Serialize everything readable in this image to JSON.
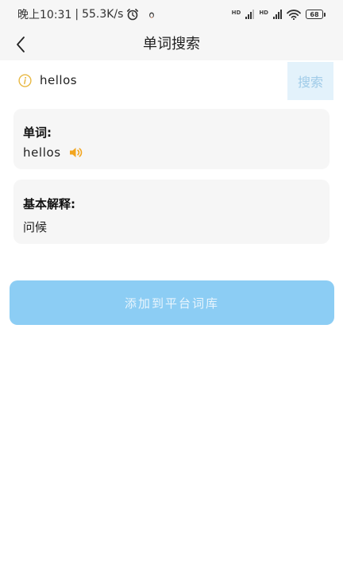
{
  "status_bar": {
    "time": "晚上10:31",
    "separator": "|",
    "net_speed": "55.3K/s",
    "battery": "68",
    "sim1_label": "HD",
    "sim2_label": "HD"
  },
  "nav": {
    "title": "单词搜索"
  },
  "search": {
    "value": "hellos",
    "button_label": "搜索"
  },
  "word_card": {
    "label": "单词:",
    "word": "hellos"
  },
  "definition_card": {
    "label": "基本解释:",
    "text": "问候"
  },
  "add_button": {
    "label": "添加到平台词库"
  },
  "colors": {
    "accent": "#8ccdf4",
    "search_button_bg": "#e3f2fb",
    "info_icon": "#e8b842",
    "speaker_icon": "#f2a51f"
  },
  "icons": {
    "back": "chevron-left-icon",
    "info": "info-icon",
    "speaker": "speaker-icon",
    "alarm": "alarm-clock-icon",
    "wifi": "wifi-icon"
  }
}
